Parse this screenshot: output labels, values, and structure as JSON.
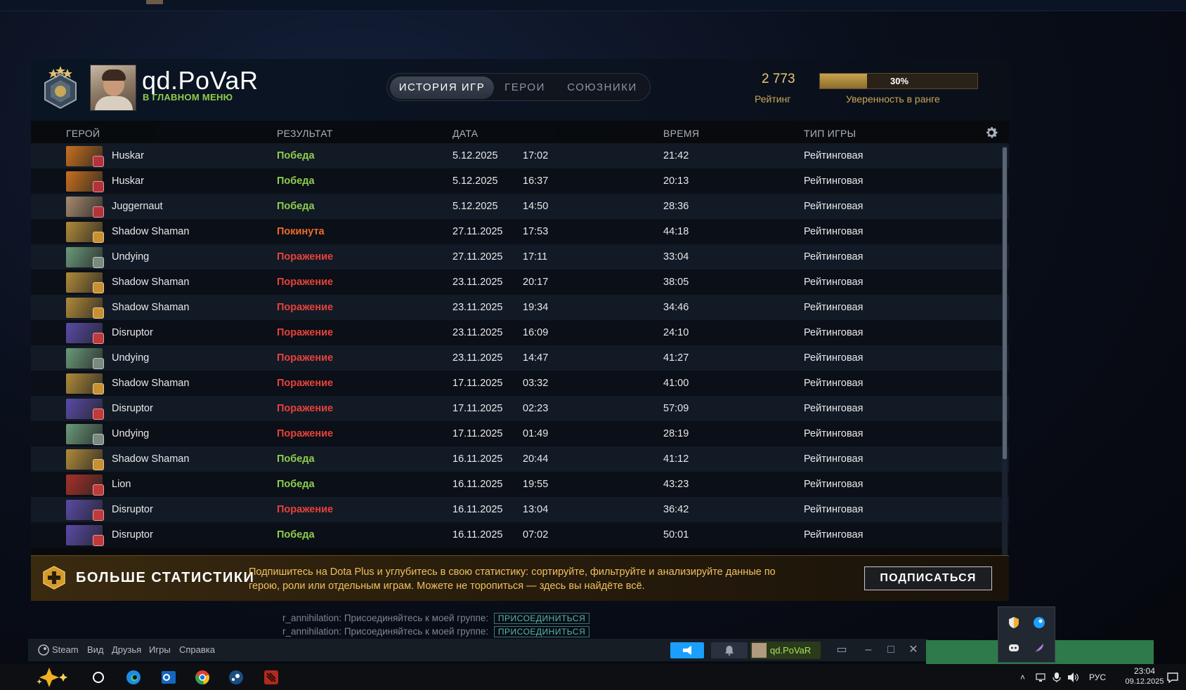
{
  "profile": {
    "username": "qd.PoVaR",
    "status": "В ГЛАВНОМ МЕНЮ",
    "rating_value": "2 773",
    "rating_label": "Рейтинг",
    "confidence_percent": 30,
    "confidence_text": "30%",
    "confidence_label": "Уверенность в ранге"
  },
  "tabs": [
    {
      "label": "ИСТОРИЯ ИГР",
      "active": true
    },
    {
      "label": "ГЕРОИ",
      "active": false
    },
    {
      "label": "СОЮЗНИКИ",
      "active": false
    }
  ],
  "columns": {
    "hero": "ГЕРОЙ",
    "result": "РЕЗУЛЬТАТ",
    "date": "ДАТА",
    "duration": "ВРЕМЯ",
    "game_type": "ТИП ИГРЫ"
  },
  "matches": [
    {
      "hero": "Huskar",
      "result": "Победа",
      "outcome": "win",
      "date": "5.12.2025",
      "time": "17:02",
      "duration": "21:42",
      "type": "Рейтинговая",
      "hero_color": "#c8701e",
      "attr_color": "#b5323c"
    },
    {
      "hero": "Huskar",
      "result": "Победа",
      "outcome": "win",
      "date": "5.12.2025",
      "time": "16:37",
      "duration": "20:13",
      "type": "Рейтинговая",
      "hero_color": "#c8701e",
      "attr_color": "#b5323c"
    },
    {
      "hero": "Juggernaut",
      "result": "Победа",
      "outcome": "win",
      "date": "5.12.2025",
      "time": "14:50",
      "duration": "28:36",
      "type": "Рейтинговая",
      "hero_color": "#a68a6e",
      "attr_color": "#b5323c"
    },
    {
      "hero": "Shadow Shaman",
      "result": "Покинута",
      "outcome": "abandon",
      "date": "27.11.2025",
      "time": "17:53",
      "duration": "44:18",
      "type": "Рейтинговая",
      "hero_color": "#b08a3a",
      "attr_color": "#c89030"
    },
    {
      "hero": "Undying",
      "result": "Поражение",
      "outcome": "loss",
      "date": "27.11.2025",
      "time": "17:11",
      "duration": "33:04",
      "type": "Рейтинговая",
      "hero_color": "#6a9a7a",
      "attr_color": "#7a8a80"
    },
    {
      "hero": "Shadow Shaman",
      "result": "Поражение",
      "outcome": "loss",
      "date": "23.11.2025",
      "time": "20:17",
      "duration": "38:05",
      "type": "Рейтинговая",
      "hero_color": "#b08a3a",
      "attr_color": "#c89030"
    },
    {
      "hero": "Shadow Shaman",
      "result": "Поражение",
      "outcome": "loss",
      "date": "23.11.2025",
      "time": "19:34",
      "duration": "34:46",
      "type": "Рейтинговая",
      "hero_color": "#b08a3a",
      "attr_color": "#c89030"
    },
    {
      "hero": "Disruptor",
      "result": "Поражение",
      "outcome": "loss",
      "date": "23.11.2025",
      "time": "16:09",
      "duration": "24:10",
      "type": "Рейтинговая",
      "hero_color": "#5a4aa8",
      "attr_color": "#c03a3a"
    },
    {
      "hero": "Undying",
      "result": "Поражение",
      "outcome": "loss",
      "date": "23.11.2025",
      "time": "14:47",
      "duration": "41:27",
      "type": "Рейтинговая",
      "hero_color": "#6a9a7a",
      "attr_color": "#7a8a80"
    },
    {
      "hero": "Shadow Shaman",
      "result": "Поражение",
      "outcome": "loss",
      "date": "17.11.2025",
      "time": "03:32",
      "duration": "41:00",
      "type": "Рейтинговая",
      "hero_color": "#b08a3a",
      "attr_color": "#c89030"
    },
    {
      "hero": "Disruptor",
      "result": "Поражение",
      "outcome": "loss",
      "date": "17.11.2025",
      "time": "02:23",
      "duration": "57:09",
      "type": "Рейтинговая",
      "hero_color": "#5a4aa8",
      "attr_color": "#c03a3a"
    },
    {
      "hero": "Undying",
      "result": "Поражение",
      "outcome": "loss",
      "date": "17.11.2025",
      "time": "01:49",
      "duration": "28:19",
      "type": "Рейтинговая",
      "hero_color": "#6a9a7a",
      "attr_color": "#7a8a80"
    },
    {
      "hero": "Shadow Shaman",
      "result": "Победа",
      "outcome": "win",
      "date": "16.11.2025",
      "time": "20:44",
      "duration": "41:12",
      "type": "Рейтинговая",
      "hero_color": "#b08a3a",
      "attr_color": "#c89030"
    },
    {
      "hero": "Lion",
      "result": "Победа",
      "outcome": "win",
      "date": "16.11.2025",
      "time": "19:55",
      "duration": "43:23",
      "type": "Рейтинговая",
      "hero_color": "#a8302a",
      "attr_color": "#c03a3a"
    },
    {
      "hero": "Disruptor",
      "result": "Поражение",
      "outcome": "loss",
      "date": "16.11.2025",
      "time": "13:04",
      "duration": "36:42",
      "type": "Рейтинговая",
      "hero_color": "#5a4aa8",
      "attr_color": "#c03a3a"
    },
    {
      "hero": "Disruptor",
      "result": "Победа",
      "outcome": "win",
      "date": "16.11.2025",
      "time": "07:02",
      "duration": "50:01",
      "type": "Рейтинговая",
      "hero_color": "#5a4aa8",
      "attr_color": "#c03a3a"
    }
  ],
  "promo": {
    "title": "БОЛЬШЕ СТАТИСТИКИ",
    "text": "Подпишитесь на Dota Plus и углубитесь в свою статистику: сортируйте, фильтруйте и анализируйте данные по герою, роли или отдельным играм. Можете не торопиться — здесь вы найдёте всё.",
    "button": "ПОДПИСАТЬСЯ"
  },
  "chat": [
    {
      "sender": "r_annihilation",
      "message": "Присоединяйтесь к моей группе:",
      "join": "ПРИСОЕДИНИТЬСЯ"
    },
    {
      "sender": "r_annihilation",
      "message": "Присоединяйтесь к моей группе:",
      "join": "ПРИСОЕДИНИТЬСЯ"
    }
  ],
  "steam": {
    "menu": [
      "Steam",
      "Вид",
      "Друзья",
      "Игры",
      "Справка"
    ],
    "username": "qd.PoVaR"
  },
  "taskbar": {
    "language": "РУС",
    "time": "23:04",
    "date": "09.12.2025"
  },
  "colors": {
    "win": "#8fce4a",
    "loss": "#e8423a",
    "abandon": "#f06a2a",
    "accent_gold": "#c9a85a"
  }
}
